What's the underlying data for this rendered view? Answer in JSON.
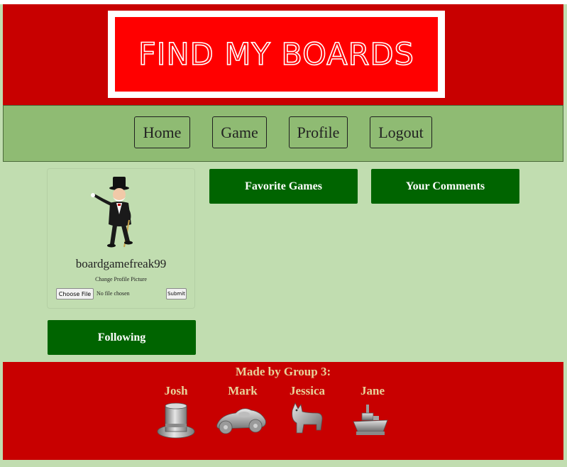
{
  "header": {
    "logo_text": "FIND MY BOARDS"
  },
  "nav": {
    "home": "Home",
    "game": "Game",
    "profile": "Profile",
    "logout": "Logout"
  },
  "profile": {
    "avatar_icon": "monopoly-man-icon",
    "username": "boardgamefreak99",
    "change_picture_label": "Change Profile Picture",
    "choose_file_label": "Choose File",
    "no_file_text": "No file chosen",
    "submit_label": "Submit"
  },
  "buttons": {
    "favorite_games": "Favorite Games",
    "your_comments": "Your Comments",
    "following": "Following"
  },
  "footer": {
    "made_by": "Made by Group 3:",
    "members": [
      {
        "name": "Josh",
        "icon": "top-hat-token-icon"
      },
      {
        "name": "Mark",
        "icon": "race-car-token-icon"
      },
      {
        "name": "Jessica",
        "icon": "scottie-dog-token-icon"
      },
      {
        "name": "Jane",
        "icon": "battleship-token-icon"
      }
    ]
  },
  "colors": {
    "header_red": "#c80000",
    "logo_red": "#ff0000",
    "nav_green": "#8fbb73",
    "page_bg": "#c1ddb0",
    "button_green": "#006400",
    "footer_text": "#e8d29a"
  }
}
